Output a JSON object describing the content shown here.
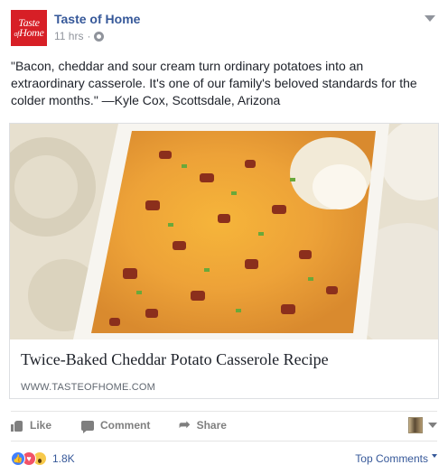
{
  "page": {
    "name": "Taste of Home",
    "logo_line1": "Taste",
    "logo_line2_small": "of",
    "logo_line2": "Home",
    "timestamp": "11 hrs",
    "separator": "·",
    "audience_icon": "globe-icon"
  },
  "post": {
    "text": "\"Bacon, cheddar and sour cream turn ordinary potatoes into an extraordinary casserole. It's one of our family's beloved standards for the colder months.\" —Kyle Cox, Scottsdale, Arizona"
  },
  "link": {
    "title": "Twice-Baked Cheddar Potato Casserole Recipe",
    "domain": "WWW.TASTEOFHOME.COM",
    "image_icon": "casserole-photo"
  },
  "actions": {
    "like": "Like",
    "comment": "Comment",
    "share": "Share"
  },
  "reactions": {
    "types": [
      "like",
      "love",
      "wow"
    ],
    "count": "1.8K"
  },
  "comments": {
    "sort_label": "Top Comments"
  },
  "colors": {
    "brand_red": "#d71f26",
    "link_blue": "#365899",
    "muted": "#90949c"
  }
}
